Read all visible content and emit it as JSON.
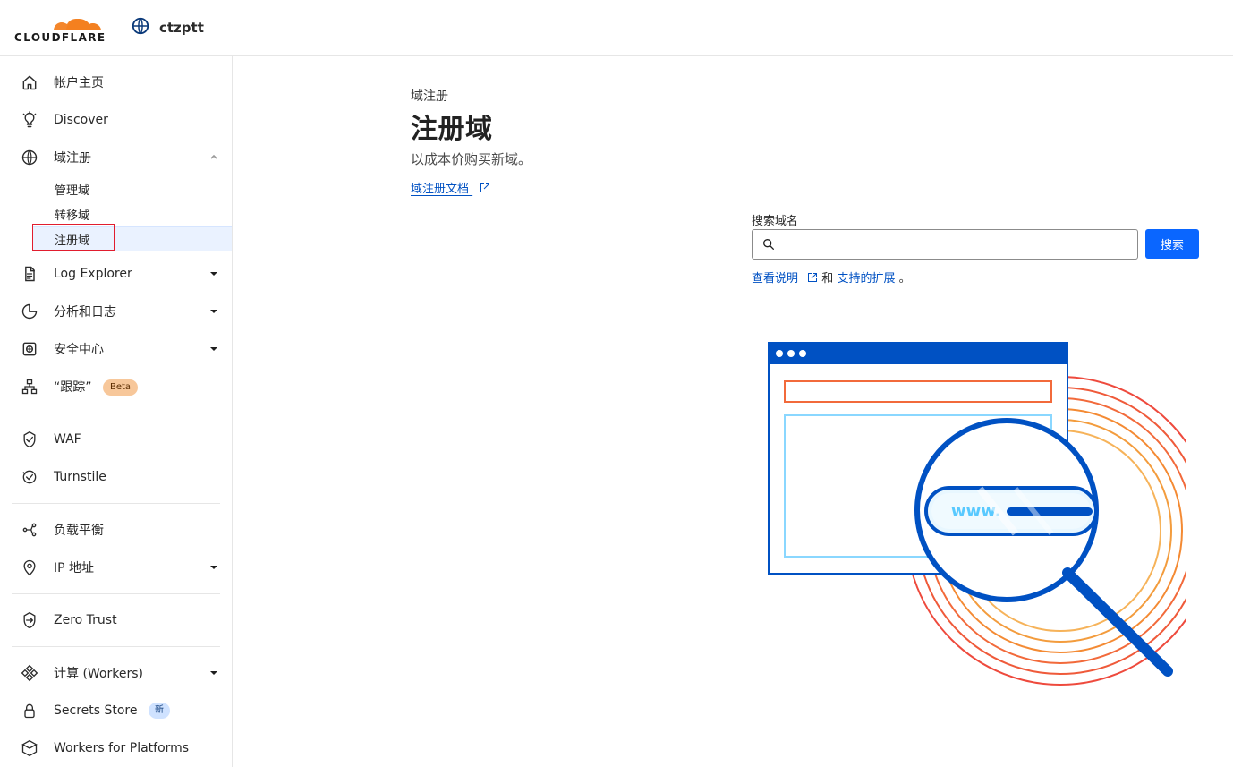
{
  "header": {
    "brand": "CLOUDFLARE",
    "account_name": "ctzptt",
    "colors": {
      "orange": "#f38020",
      "text": "#1b1b1b"
    }
  },
  "sidebar": {
    "items": [
      {
        "label": "帐户主页",
        "icon": "home-icon"
      },
      {
        "label": "Discover",
        "icon": "bulb-icon"
      },
      {
        "label": "域注册",
        "icon": "globe-icon",
        "expanded": true
      },
      {
        "label": "Log Explorer",
        "icon": "log-icon",
        "has_caret": true
      },
      {
        "label": "分析和日志",
        "icon": "chart-icon",
        "has_caret": true
      },
      {
        "label": "安全中心",
        "icon": "security-icon",
        "has_caret": true
      },
      {
        "label": "“跟踪”",
        "icon": "trace-icon",
        "badge": "Beta"
      },
      {
        "label": "WAF",
        "icon": "waf-icon"
      },
      {
        "label": "Turnstile",
        "icon": "turnstile-icon"
      },
      {
        "label": "负载平衡",
        "icon": "load-balance-icon"
      },
      {
        "label": "IP 地址",
        "icon": "location-icon",
        "has_caret": true
      },
      {
        "label": "Zero Trust",
        "icon": "zero-trust-icon"
      },
      {
        "label": "计算 (Workers)",
        "icon": "workers-icon",
        "has_caret": true
      },
      {
        "label": "Secrets Store",
        "icon": "lock-icon",
        "badge": "新"
      },
      {
        "label": "Workers for Platforms",
        "icon": "box-icon"
      }
    ],
    "domain_subitems": [
      {
        "label": "管理域"
      },
      {
        "label": "转移域"
      },
      {
        "label": "注册域",
        "active": true
      }
    ]
  },
  "main": {
    "breadcrumb": "域注册",
    "title": "注册域",
    "subtitle": "以成本价购买新域。",
    "doc_link": "域注册文档",
    "search": {
      "label": "搜索域名",
      "placeholder": "",
      "value": "",
      "button": "搜索"
    },
    "help": {
      "link1": "查看说明",
      "between": "和",
      "link2": "支持的扩展",
      "end": "。"
    },
    "illustration": {
      "text": "www.",
      "colors": {
        "blue": "#0051c3",
        "light_blue": "#8ad7ff",
        "orange": "#f38020",
        "red": "#e11d2e"
      }
    }
  }
}
